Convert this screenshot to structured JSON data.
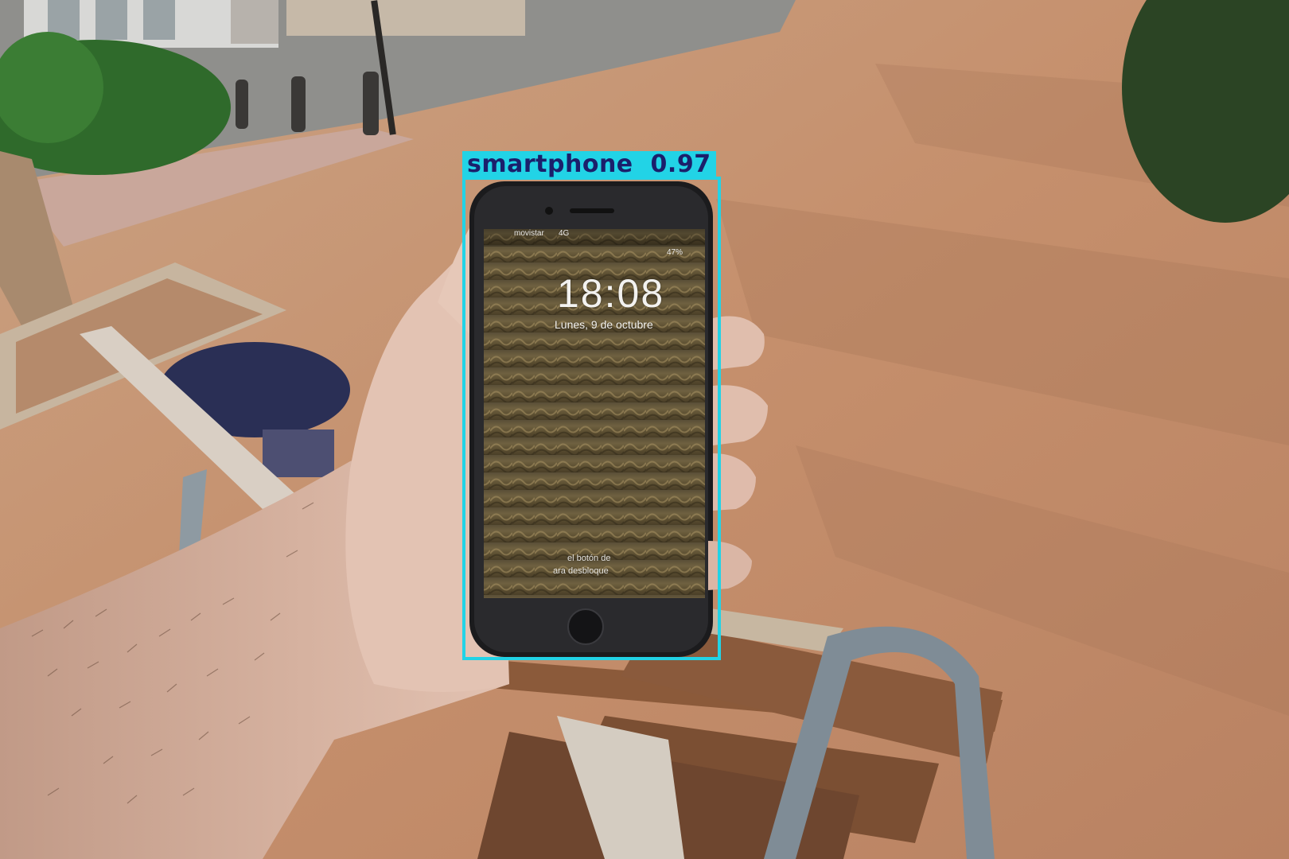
{
  "detection": {
    "label": "smartphone",
    "confidence": "0.97",
    "box_color": "#22d3e6",
    "text_color": "#1b1f6b"
  },
  "phone_screen": {
    "carrier": "movistar",
    "network": "4G",
    "battery": "47%",
    "time": "18:08",
    "date": "Lunes, 9 de octubre",
    "unlock_line1": "el botón de",
    "unlock_line2": "ara desbloque"
  }
}
